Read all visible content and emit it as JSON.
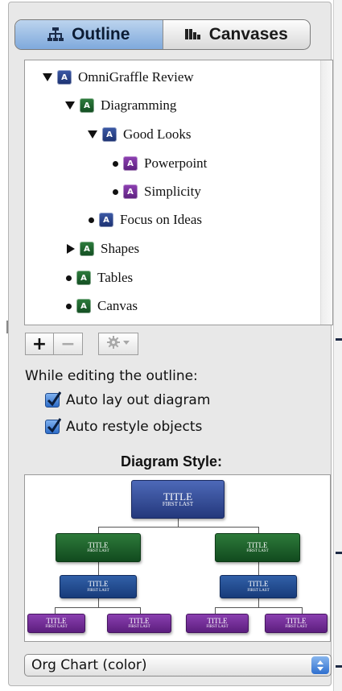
{
  "segmented": {
    "outline_label": "Outline",
    "canvases_label": "Canvases",
    "selected": "Outline"
  },
  "outline": {
    "items": [
      {
        "label": "OmniGraffle Review",
        "badge": "A",
        "badge_color": "blue",
        "disclosure": "expanded"
      },
      {
        "label": "Diagramming",
        "badge": "A",
        "badge_color": "green",
        "disclosure": "expanded"
      },
      {
        "label": "Good Looks",
        "badge": "A",
        "badge_color": "blue",
        "disclosure": "expanded"
      },
      {
        "label": "Powerpoint",
        "badge": "A",
        "badge_color": "purple",
        "disclosure": "bullet"
      },
      {
        "label": "Simplicity",
        "badge": "A",
        "badge_color": "purple",
        "disclosure": "bullet"
      },
      {
        "label": "Focus on Ideas",
        "badge": "A",
        "badge_color": "blue",
        "disclosure": "bullet"
      },
      {
        "label": "Shapes",
        "badge": "A",
        "badge_color": "green",
        "disclosure": "collapsed"
      },
      {
        "label": "Tables",
        "badge": "A",
        "badge_color": "green",
        "disclosure": "bullet"
      },
      {
        "label": "Canvas",
        "badge": "A",
        "badge_color": "green",
        "disclosure": "bullet"
      }
    ]
  },
  "buttons": {
    "add_label": "+",
    "remove_label": "−",
    "gear_icon": "gear-icon"
  },
  "editing": {
    "heading": "While editing the outline:",
    "auto_layout_label": "Auto lay out diagram",
    "auto_layout_checked": true,
    "auto_restyle_label": "Auto restyle objects",
    "auto_restyle_checked": true
  },
  "diagram_style": {
    "title": "Diagram Style:",
    "node_title": "TITLE",
    "node_subtitle": "FIRST LAST",
    "selected_style": "Org Chart (color)"
  },
  "colors": {
    "segment_active": "#7fa9dc",
    "badge_blue": "#2a3f8a",
    "badge_green": "#1a5e2b",
    "badge_purple": "#7433a0",
    "checkbox_blue": "#2d6cc8"
  }
}
